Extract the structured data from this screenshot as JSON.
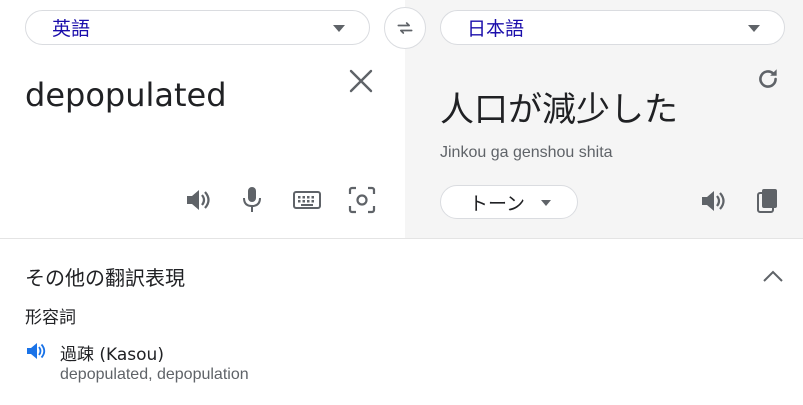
{
  "source": {
    "language": "英語",
    "text": "depopulated"
  },
  "target": {
    "language": "日本語",
    "text": "人口が減少した",
    "romanization": "Jinkou ga genshou shita",
    "tone_label": "トーン"
  },
  "more_translations": {
    "title": "その他の翻訳表現",
    "part_of_speech": "形容詞",
    "entries": [
      {
        "term": "過疎 (Kasou)",
        "synonyms": "depopulated, depopulation"
      }
    ]
  },
  "icons": {
    "swap": "swap-arrows-icon",
    "clear": "close-icon",
    "listen": "speaker-icon",
    "mic": "microphone-icon",
    "keyboard": "keyboard-icon",
    "camera": "camera-icon",
    "refresh": "refresh-icon",
    "copy": "copy-icon",
    "collapse": "chevron-up-icon"
  },
  "colors": {
    "language_text": "#1a0dab",
    "accent_blue": "#1a73e8",
    "icon_gray": "#5f6368",
    "target_pane_bg": "#f5f5f5"
  }
}
